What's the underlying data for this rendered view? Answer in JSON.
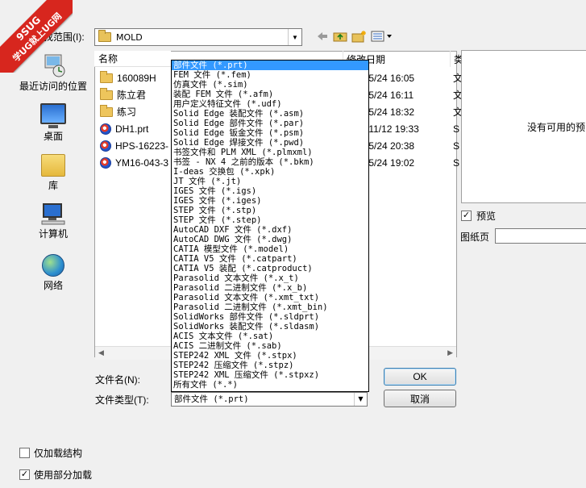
{
  "watermark": {
    "line1": "9SUG",
    "line2": "学UG就上UG网"
  },
  "lookin": {
    "label": "查找范围(I):",
    "value": "MOLD"
  },
  "places": [
    {
      "label": "最近访问的位置",
      "icon": "recent-places-icon"
    },
    {
      "label": "桌面",
      "icon": "desktop-icon"
    },
    {
      "label": "库",
      "icon": "library-icon"
    },
    {
      "label": "计算机",
      "icon": "computer-icon"
    },
    {
      "label": "网络",
      "icon": "network-icon"
    }
  ],
  "columns": {
    "name": "名称",
    "date": "修改日期",
    "more": "类"
  },
  "files": [
    {
      "name": "160089H",
      "type": "folder",
      "date": "/5/24 16:05",
      "extra": "文"
    },
    {
      "name": "陈立君",
      "type": "folder",
      "date": "/5/24 16:11",
      "extra": "文"
    },
    {
      "name": "练习",
      "type": "folder",
      "date": "/5/24 18:32",
      "extra": "文"
    },
    {
      "name": "DH1.prt",
      "type": "prt",
      "date": "/11/12 19:33",
      "extra": "S"
    },
    {
      "name": "HPS-16223-",
      "type": "prt",
      "date": "/5/24 20:38",
      "extra": "S"
    },
    {
      "name": "YM16-043-3",
      "type": "prt",
      "date": "/5/24 19:02",
      "extra": "S"
    }
  ],
  "preview": {
    "message": "没有可用的预",
    "checkbox_label": "预览",
    "drawing_label": "图纸页"
  },
  "form": {
    "filename_label": "文件名(N):",
    "filetype_label": "文件类型(T):",
    "filetype_value": "部件文件 (*.prt)",
    "ok_label": "OK",
    "cancel_label": "取消"
  },
  "options": {
    "load_structure_label": "仅加载结构",
    "partial_load_label": "使用部分加载"
  },
  "dropdown_items": [
    "部件文件 (*.prt)",
    "FEM 文件 (*.fem)",
    "仿真文件 (*.sim)",
    "装配 FEM 文件 (*.afm)",
    "用户定义特征文件 (*.udf)",
    "Solid Edge 装配文件 (*.asm)",
    "Solid Edge 部件文件 (*.par)",
    "Solid Edge 钣金文件 (*.psm)",
    "Solid Edge 焊接文件 (*.pwd)",
    "书签文件和 PLM XML (*.plmxml)",
    "书签 - NX 4 之前的版本 (*.bkm)",
    "I-deas 交换包 (*.xpk)",
    "JT 文件 (*.jt)",
    "IGES 文件 (*.igs)",
    "IGES 文件 (*.iges)",
    "STEP 文件 (*.stp)",
    "STEP 文件 (*.step)",
    "AutoCAD DXF 文件 (*.dxf)",
    "AutoCAD DWG 文件 (*.dwg)",
    "CATIA 模型文件 (*.model)",
    "CATIA V5 文件 (*.catpart)",
    "CATIA V5 装配 (*.catproduct)",
    "Parasolid 文本文件 (*.x_t)",
    "Parasolid 二进制文件 (*.x_b)",
    "Parasolid 文本文件 (*.xmt_txt)",
    "Parasolid 二进制文件 (*.xmt_bin)",
    "SolidWorks 部件文件 (*.sldprt)",
    "SolidWorks 装配文件 (*.sldasm)",
    "ACIS 文本文件 (*.sat)",
    "ACIS 二进制文件 (*.sab)",
    "STEP242 XML 文件 (*.stpx)",
    "STEP242 压缩文件 (*.stpz)",
    "STEP242 XML 压缩文件 (*.stpxz)",
    "所有文件 (*.*)"
  ],
  "selected_index": 0,
  "colors": {
    "selection": "#3399ff",
    "watermark": "#d7261e"
  }
}
